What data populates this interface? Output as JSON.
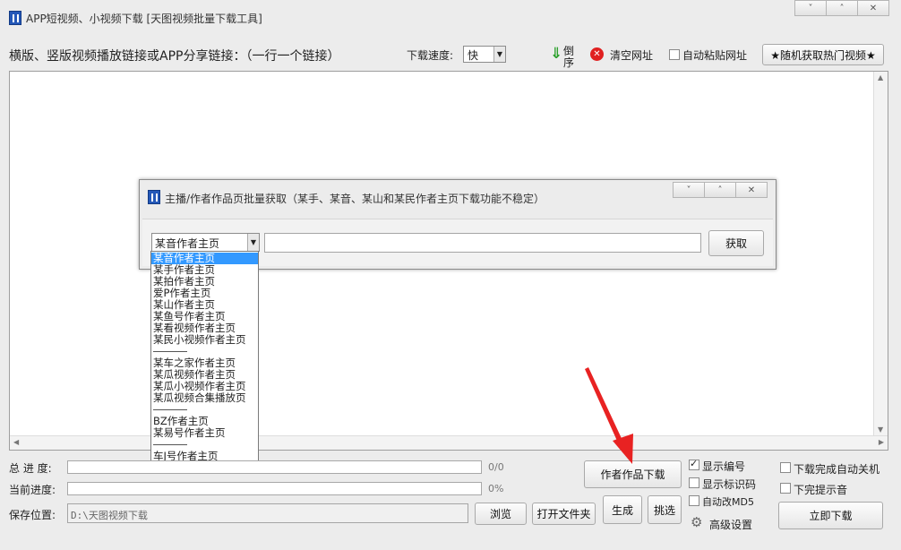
{
  "window": {
    "title": "APP短视频、小视频下载 [天图视频批量下载工具]",
    "controls": [
      "˅",
      "˄",
      "✕"
    ]
  },
  "toolbar": {
    "url_label": "横版、竖版视频播放链接或APP分享链接：（一行一个链接）",
    "speed_label": "下载速度:",
    "speed_value": "快",
    "reverse_label_1": "倒",
    "reverse_label_2": "序",
    "clear_label": "清空网址",
    "auto_paste_label": "自动粘贴网址",
    "hot_video_label": "★随机获取热门视频★"
  },
  "dialog": {
    "title": "主播/作者作品页批量获取（某手、某音、某山和某民作者主页下载功能不稳定）",
    "controls": [
      "˅",
      "˄",
      "✕"
    ],
    "select_value": "某音作者主页",
    "url_value": "",
    "fetch_label": "获取",
    "options": [
      {
        "label": "某音作者主页",
        "selected": true
      },
      {
        "label": "某手作者主页"
      },
      {
        "label": "某拍作者主页"
      },
      {
        "label": "爱P作者主页"
      },
      {
        "label": "某山作者主页"
      },
      {
        "label": "某鱼号作者主页"
      },
      {
        "label": "某看视频作者主页"
      },
      {
        "label": "某民小视频作者主页"
      },
      {
        "separator": true
      },
      {
        "label": "某车之家作者主页"
      },
      {
        "label": "某瓜视频作者主页"
      },
      {
        "label": "某瓜小视频作者主页"
      },
      {
        "label": "某瓜视频合集播放页"
      },
      {
        "separator": true
      },
      {
        "label": "BZ作者主页"
      },
      {
        "label": "某易号作者主页"
      },
      {
        "separator": true
      },
      {
        "label": "车J号作者主页"
      }
    ]
  },
  "bottom": {
    "total_label": "总 进 度:",
    "total_value": "0/0",
    "current_label": "当前进度:",
    "current_value": "0%",
    "save_label": "保存位置:",
    "save_path": "D:\\天图视频下载",
    "browse_label": "浏览",
    "open_folder_label": "打开文件夹",
    "author_download_label": "作者作品下载",
    "generate_label": "生成",
    "pick_label": "挑选",
    "show_number_label": "显示编号",
    "show_number_checked": true,
    "show_id_label": "显示标识码",
    "auto_md5_label": "自动改MD5",
    "advanced_label": "高级设置",
    "auto_shutdown_label": "下载完成自动关机",
    "sound_label": "下完提示音",
    "download_now_label": "立即下载"
  }
}
